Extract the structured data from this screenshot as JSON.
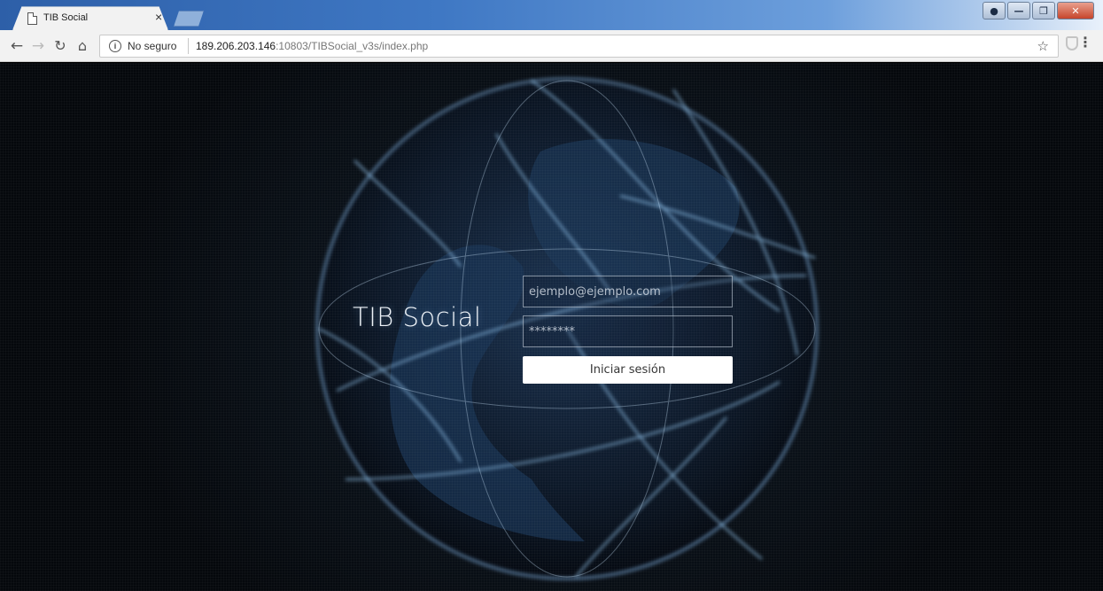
{
  "browser": {
    "tab_title": "TIB Social",
    "tab_close": "×",
    "security_label": "No seguro",
    "url_host": "189.206.203.146",
    "url_rest": ":10803/TIBSocial_v3s/index.php"
  },
  "login": {
    "brand": "TIB Social",
    "email_placeholder": "ejemplo@ejemplo.com",
    "password_placeholder": "********",
    "submit_label": "Iniciar sesión"
  }
}
